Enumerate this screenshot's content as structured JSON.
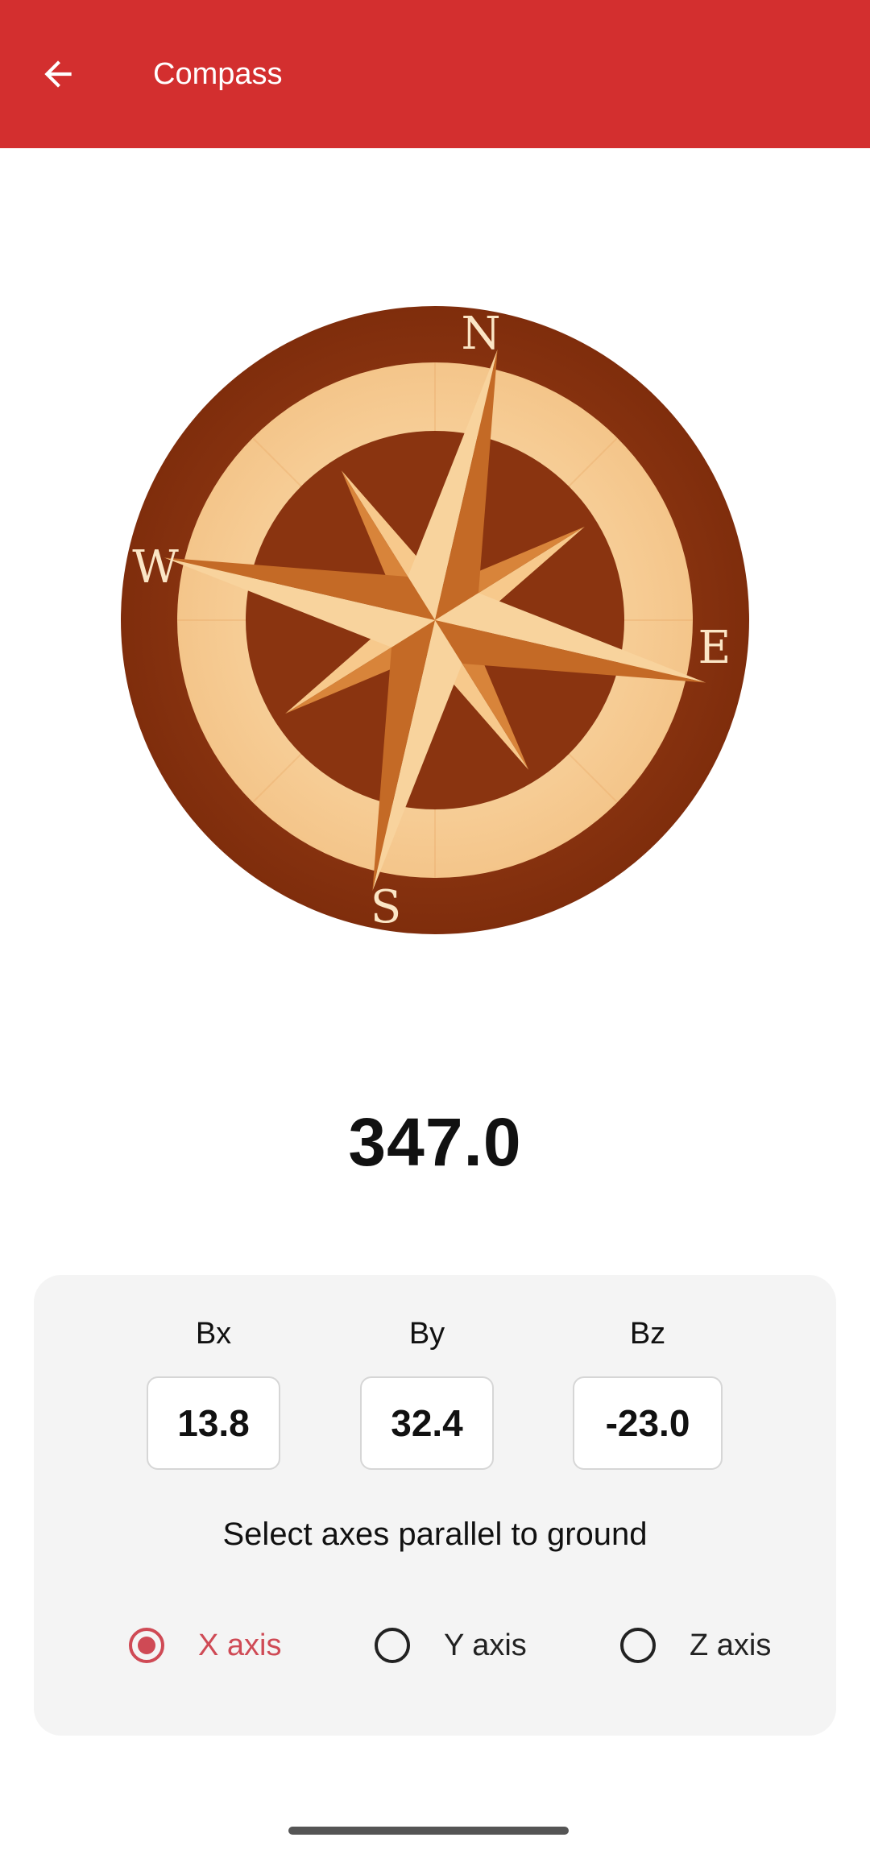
{
  "appbar": {
    "title": "Compass",
    "back_icon": "arrow-left-icon"
  },
  "compass": {
    "north": "N",
    "east": "E",
    "south": "S",
    "west": "W"
  },
  "heading": "347.0",
  "sensor": {
    "bx": {
      "label": "Bx",
      "value": "13.8"
    },
    "by": {
      "label": "By",
      "value": "32.4"
    },
    "bz": {
      "label": "Bz",
      "value": "-23.0"
    }
  },
  "axes": {
    "prompt": "Select axes parallel to ground",
    "options": [
      {
        "label": "X axis",
        "selected": true
      },
      {
        "label": "Y axis",
        "selected": false
      },
      {
        "label": "Z axis",
        "selected": false
      }
    ]
  },
  "colors": {
    "appbar": "#d32f2f",
    "accent": "#cf4a55"
  }
}
